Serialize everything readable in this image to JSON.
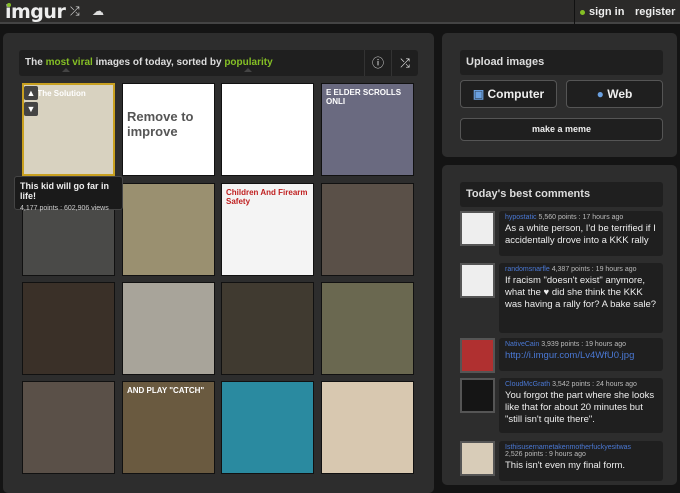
{
  "header": {
    "logo": "imgur",
    "sign_in": "sign in",
    "register": "register"
  },
  "gallery": {
    "title_pre": "The ",
    "title_hl1": "most viral",
    "title_mid": " images of today, sorted by ",
    "title_hl2": "popularity",
    "tooltip": {
      "title": "This kid will go far in life!",
      "stats": "4,177 points : 602,906 views"
    },
    "thumbs": [
      {
        "label": "In The Solution",
        "bg": "#d8d2c0"
      },
      {
        "label": "Remove to improve",
        "bg": "#ffffff"
      },
      {
        "label": "",
        "bg": "#ffffff"
      },
      {
        "label": "E ELDER SCROLLS ONLI",
        "bg": "#6a6a80"
      },
      {
        "label": "",
        "bg": "#4a4a48"
      },
      {
        "label": "",
        "bg": "#9a9070"
      },
      {
        "label": "Children And Firearm Safety",
        "bg": "#f4f4f4"
      },
      {
        "label": "",
        "bg": "#5a5048"
      },
      {
        "label": "",
        "bg": "#3a3028"
      },
      {
        "label": "",
        "bg": "#a8a49a"
      },
      {
        "label": "",
        "bg": "#403a30"
      },
      {
        "label": "",
        "bg": "#6a6850"
      },
      {
        "label": "",
        "bg": "#5a5048"
      },
      {
        "label": "AND PLAY \"CATCH\"",
        "bg": "#6a5a40"
      },
      {
        "label": "",
        "bg": "#2a8aa0"
      },
      {
        "label": "",
        "bg": "#d8c8b0"
      }
    ]
  },
  "upload": {
    "title": "Upload images",
    "computer": "Computer",
    "web": "Web",
    "meme": "make a meme"
  },
  "comments": {
    "title": "Today's best comments",
    "items": [
      {
        "user": "hypostatic",
        "meta": "5,560 points : 17 hours ago",
        "text": "As a white person, I'd be terrified if I accidentally drove into a KKK rally"
      },
      {
        "user": "randomsnarfle",
        "meta": "4,387 points : 19 hours ago",
        "text": "If racism \"doesn't exist\" anymore, what the ♥ did she think the KKK was having a rally for? A bake sale?"
      },
      {
        "user": "NativeCain",
        "meta": "3,939 points : 19 hours ago",
        "text": "http://i.imgur.com/Lv4WfU0.jpg"
      },
      {
        "user": "CloudMcGrath",
        "meta": "3,542 points : 24 hours ago",
        "text": "You forgot the part where she looks like that for about 20 minutes but \"still isn't quite there\"."
      },
      {
        "user": "Isthisusernametakenmotherfuckyesitwas",
        "meta": "2,526 points : 9 hours ago",
        "text": "This isn't even my final form."
      }
    ]
  }
}
